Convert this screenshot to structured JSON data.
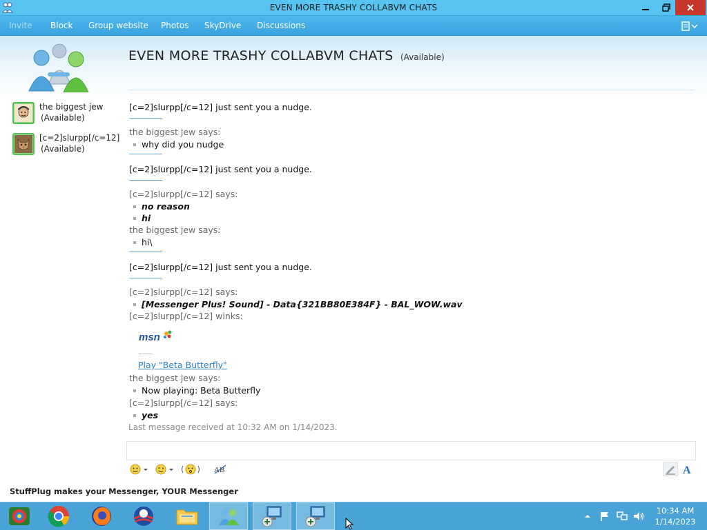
{
  "window": {
    "title": "EVEN MORE TRASHY COLLABVM CHATS"
  },
  "menu": {
    "items": [
      {
        "label": "Invite",
        "enabled": false
      },
      {
        "label": "Block",
        "enabled": true
      },
      {
        "label": "Group website",
        "enabled": true
      },
      {
        "label": "Photos",
        "enabled": true
      },
      {
        "label": "SkyDrive",
        "enabled": true
      },
      {
        "label": "Discussions",
        "enabled": true
      }
    ]
  },
  "conversation": {
    "title": "EVEN MORE TRASHY COLLABVM CHATS",
    "status": "(Available)"
  },
  "contacts": [
    {
      "name": "the biggest jew",
      "status": "(Available)"
    },
    {
      "name": "[c=2]slurpp[/c=12]",
      "status": "(Available)"
    }
  ],
  "chat": {
    "nudge1": "[c=2]slurpp[/c=12] just sent you a nudge.",
    "says1": "the biggest jew says:",
    "msg1": "why did you nudge",
    "nudge2": "[c=2]slurpp[/c=12] just sent you a nudge.",
    "says2": "[c=2]slurpp[/c=12] says:",
    "msg2a": "no reason",
    "msg2b": "hi",
    "says3": "the biggest jew says:",
    "msg3": "hi\\",
    "nudge3": "[c=2]slurpp[/c=12] just sent you a nudge.",
    "says4": "[c=2]slurpp[/c=12] says:",
    "msg4": "[Messenger Plus! Sound] - Data{321BB80E384F} - BAL_WOW.wav",
    "winks": "[c=2]slurpp[/c=12] winks:",
    "wink_logo": "msn",
    "wink_link": "Play \"Beta Butterfly\"",
    "says5": "the biggest jew says:",
    "msg5": "Now playing: Beta Butterfly",
    "says6": "[c=2]slurpp[/c=12] says:",
    "msg6": "yes",
    "last_message": "Last message received at 10:32 AM on 1/14/2023."
  },
  "input": {
    "value": ""
  },
  "ad": {
    "text": "StuffPlug makes your Messenger, YOUR Messenger"
  },
  "taskbar": {
    "apps": [
      "start-icon",
      "chrome-icon",
      "firefox-icon",
      "obama-icon",
      "explorer-icon",
      "messenger-icon",
      "remote-desktop-icon",
      "remote-desktop-icon"
    ],
    "clock_time": "10:34 AM",
    "clock_date": "1/14/2023"
  },
  "colors": {
    "titlebar": "#57c3f0",
    "menubar": "#3aa3e0",
    "taskbar": "#4aa3d6",
    "close": "#c7362d",
    "link": "#2e7fc0",
    "contact_border": "#52c352"
  }
}
